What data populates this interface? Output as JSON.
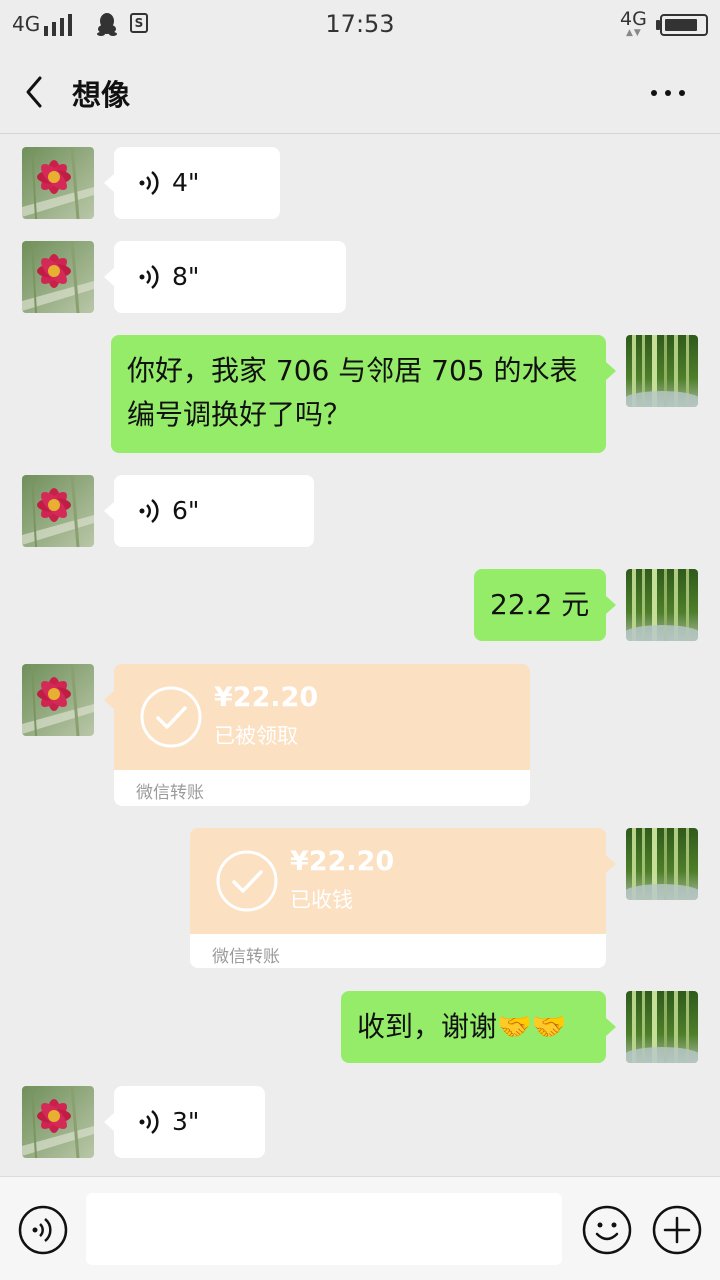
{
  "status_bar": {
    "network": "4G",
    "time": "17:53",
    "network_right": "4G",
    "battery_level": 0.8
  },
  "header": {
    "title": "想像",
    "back_icon": "chevron-left-icon",
    "more_icon": "more-dots-icon"
  },
  "messages": [
    {
      "type": "voice",
      "side": "left",
      "duration": "4\""
    },
    {
      "type": "voice",
      "side": "left",
      "duration": "8\""
    },
    {
      "type": "text",
      "side": "right",
      "text": "你好，我家 706 与邻居 705 的水表编号调换好了吗？"
    },
    {
      "type": "voice",
      "side": "left",
      "duration": "6\""
    },
    {
      "type": "text",
      "side": "right",
      "text": "22.2 元"
    },
    {
      "type": "transfer",
      "side": "left",
      "amount": "¥22.20",
      "status": "已被领取",
      "label": "微信转账"
    },
    {
      "type": "transfer",
      "side": "right",
      "amount": "¥22.20",
      "status": "已收钱",
      "label": "微信转账"
    },
    {
      "type": "text",
      "side": "right",
      "text": "收到，谢谢🤝🤝"
    },
    {
      "type": "voice",
      "side": "left",
      "duration": "3\""
    }
  ],
  "input_bar": {
    "value": "",
    "voice_icon": "voice-toggle-icon",
    "emoji_icon": "emoji-icon",
    "plus_icon": "plus-icon"
  },
  "colors": {
    "background": "#ededed",
    "self_bubble": "#95ec69",
    "other_bubble": "#ffffff",
    "transfer": "#fbe0c2"
  }
}
